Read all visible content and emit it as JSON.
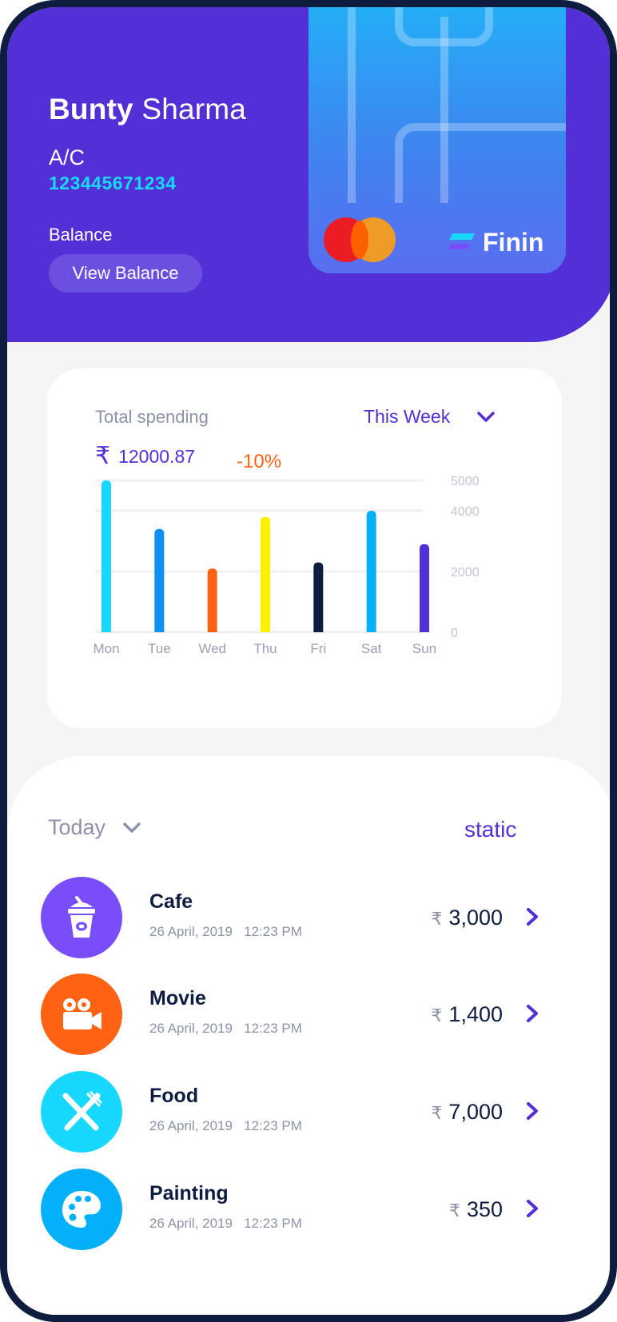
{
  "colors": {
    "primary": "#5330d6",
    "accent_cyan": "#19d8ff",
    "orange": "#ff6212",
    "navy": "#0e1d3f",
    "muted": "#8d93a7"
  },
  "header": {
    "first_name": "Bunty",
    "last_name": "Sharma",
    "ac_label": "A/C",
    "ac_number": "123445671234",
    "balance_label": "Balance",
    "view_balance_label": "View Balance"
  },
  "card": {
    "network_logo": "mastercard-logo",
    "brand_name": "Finin",
    "brand_icon": "finin-mark-icon"
  },
  "spending": {
    "title": "Total spending",
    "period": "This Week",
    "currency": "₹",
    "amount": "12000.87",
    "change": "-10%"
  },
  "chart_data": {
    "type": "bar",
    "categories": [
      "Mon",
      "Tue",
      "Wed",
      "Thu",
      "Fri",
      "Sat",
      "Sun"
    ],
    "values": [
      5000,
      3400,
      2100,
      3800,
      2300,
      4000,
      2900
    ],
    "colors": [
      "#18d8ff",
      "#0d8ff3",
      "#ff6212",
      "#fff000",
      "#0e1d3f",
      "#05b0fb",
      "#5330d6"
    ],
    "y_tick_labels": [
      "0",
      "2000",
      "4000",
      "5000"
    ],
    "y_tick_values": [
      0,
      2000,
      4000,
      5000
    ],
    "ylim": [
      0,
      5000
    ],
    "grid": true,
    "y_axis_side": "right",
    "title": "",
    "xlabel": "",
    "ylabel": ""
  },
  "transactions_panel": {
    "filter": "Today",
    "static_label": "static",
    "currency": "₹",
    "items": [
      {
        "title": "Cafe",
        "date": "26 April, 2019",
        "time": "12:23 PM",
        "amount": "3,000",
        "icon": "cafe-cup-icon",
        "color": "#7a4dfa"
      },
      {
        "title": "Movie",
        "date": "26 April, 2019",
        "time": "12:23 PM",
        "amount": "1,400",
        "icon": "movie-camera-icon",
        "color": "#ff6212"
      },
      {
        "title": "Food",
        "date": "26 April, 2019",
        "time": "12:23 PM",
        "amount": "7,000",
        "icon": "fork-knife-icon",
        "color": "#18d8ff"
      },
      {
        "title": "Painting",
        "date": "26 April, 2019",
        "time": "12:23 PM",
        "amount": "350",
        "icon": "palette-icon",
        "color": "#05b0fb"
      }
    ]
  }
}
